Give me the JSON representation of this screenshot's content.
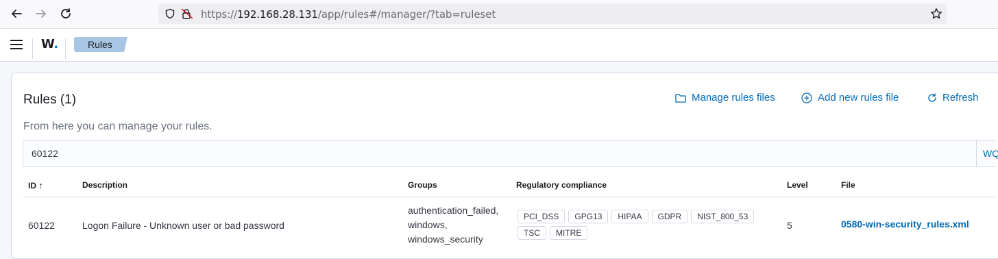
{
  "browser": {
    "url_prefix": "https://",
    "url_host": "192.168.28.131",
    "url_path": "/app/rules#/manager/?tab=ruleset"
  },
  "header": {
    "logo_letter": "W",
    "logo_dot": ".",
    "breadcrumb": "Rules"
  },
  "panel": {
    "title": "Rules (1)",
    "subtitle": "From here you can manage your rules.",
    "actions": {
      "manage": "Manage rules files",
      "add": "Add new rules file",
      "refresh": "Refresh"
    },
    "search": {
      "value": "60122",
      "wql": "WQ"
    }
  },
  "table": {
    "columns": {
      "id": "ID",
      "id_sort": "↑",
      "description": "Description",
      "groups": "Groups",
      "compliance": "Regulatory compliance",
      "level": "Level",
      "file": "File"
    },
    "rows": [
      {
        "id": "60122",
        "description": "Logon Failure - Unknown user or bad password",
        "groups": [
          "authentication_failed,",
          "windows,",
          "windows_security"
        ],
        "compliance": [
          "PCI_DSS",
          "GPG13",
          "HIPAA",
          "GDPR",
          "NIST_800_53",
          "TSC",
          "MITRE"
        ],
        "level": "5",
        "file": "0580-win-security_rules.xml"
      }
    ]
  },
  "colors": {
    "accent": "#006bb8",
    "breadcrumb_bg": "#a8c6e3"
  }
}
